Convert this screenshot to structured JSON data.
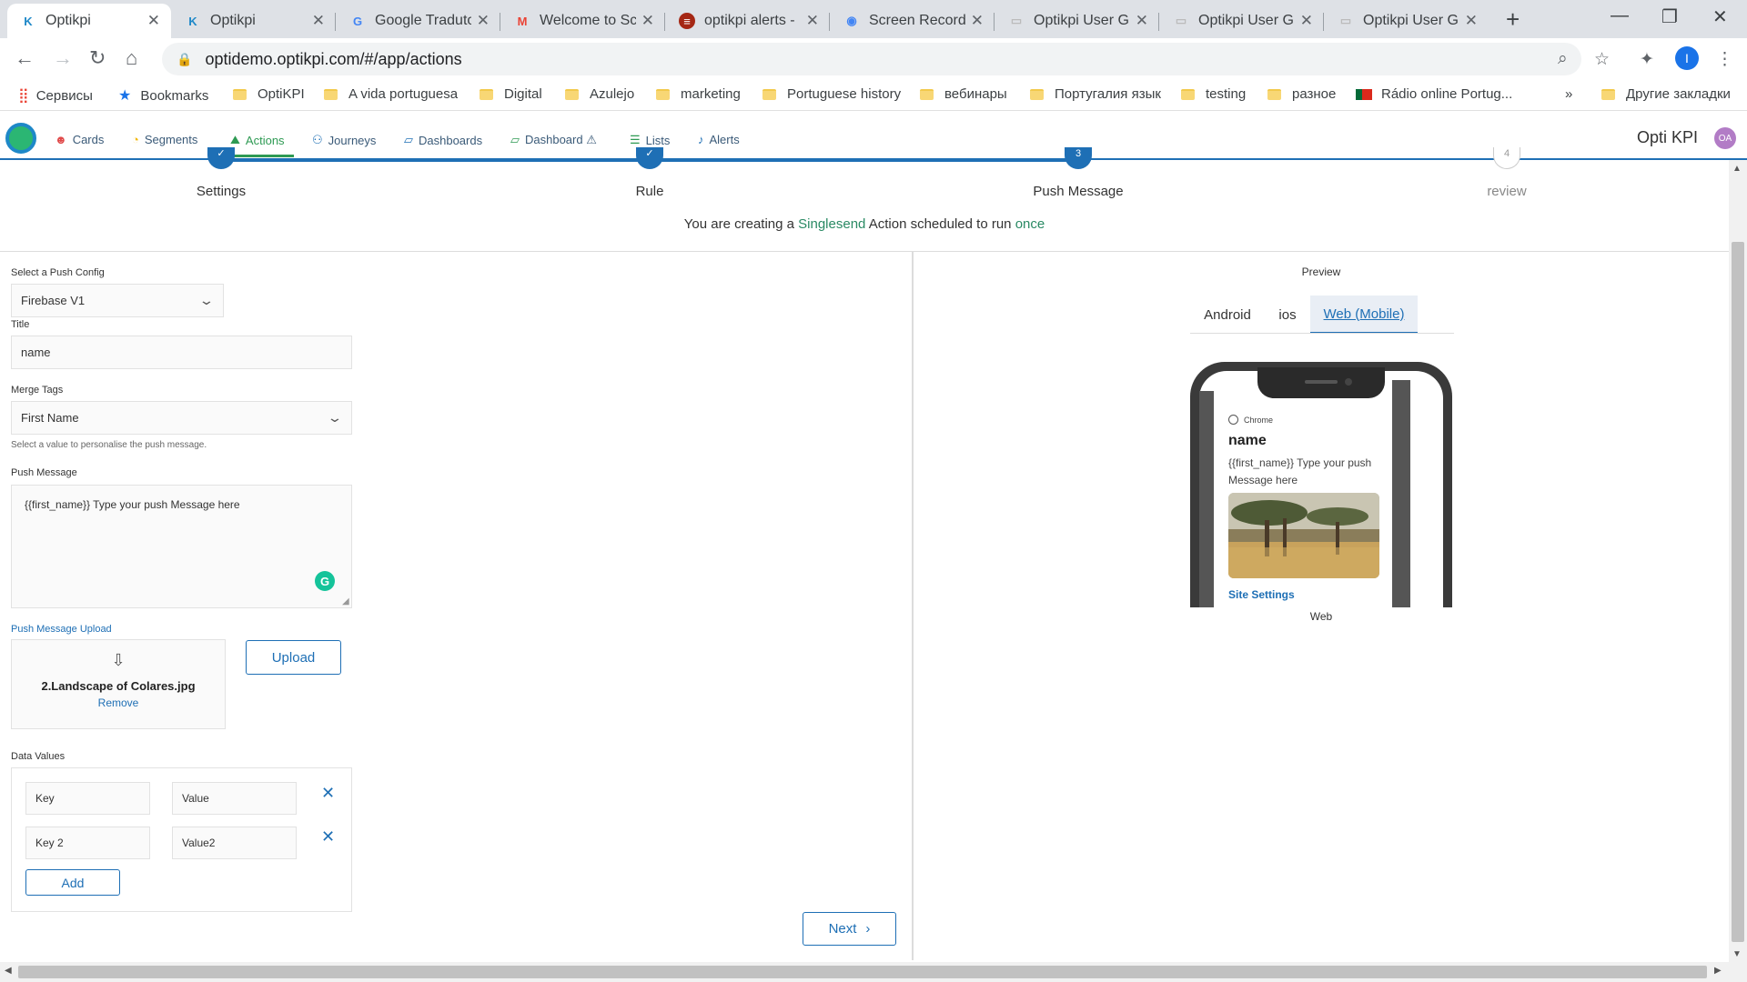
{
  "browser": {
    "tabs": [
      {
        "title": "Optikpi",
        "icon": "optikpi-icon",
        "fav": "K"
      },
      {
        "title": "Optikpi",
        "icon": "optikpi-icon",
        "fav": "K"
      },
      {
        "title": "Google Traduto",
        "icon": "google-translate-icon",
        "fav": "G"
      },
      {
        "title": "Welcome to Sc",
        "icon": "gmail-icon",
        "fav": "M"
      },
      {
        "title": "optikpi alerts -",
        "icon": "alerts-icon",
        "fav": "≡"
      },
      {
        "title": "Screen Recorde",
        "icon": "screen-recorder-icon",
        "fav": "◉"
      },
      {
        "title": "Optikpi User G",
        "icon": "doc-icon",
        "fav": "▭"
      },
      {
        "title": "Optikpi User G",
        "icon": "doc-icon",
        "fav": "▭"
      },
      {
        "title": "Optikpi User G",
        "icon": "doc-icon",
        "fav": "▭"
      }
    ],
    "url": "optidemo.optikpi.com/#/app/actions",
    "profile_initial": "I"
  },
  "bookmarks": {
    "apps": "Сервисы",
    "items": [
      "Bookmarks",
      "OptiKPI",
      "A vida portuguesa",
      "Digital",
      "Azulejo",
      "marketing",
      "Portuguese history",
      "вебинары",
      "Португалия язык",
      "testing",
      "разное",
      "Rádio online Portug..."
    ],
    "more": "»",
    "other": "Другие закладки"
  },
  "app": {
    "nav": [
      {
        "label": "Cards",
        "icon": "cards-icon",
        "glyph": "☻"
      },
      {
        "label": "Segments",
        "icon": "segments-icon",
        "glyph": "◔"
      },
      {
        "label": "Actions",
        "icon": "actions-icon",
        "glyph": "⛰"
      },
      {
        "label": "Journeys",
        "icon": "journeys-icon",
        "glyph": "⚇"
      },
      {
        "label": "Dashboards",
        "icon": "dashboards-icon",
        "glyph": "▱"
      },
      {
        "label": "Dashboard ⚠",
        "icon": "dashboard-icon",
        "glyph": "▱"
      },
      {
        "label": "Lists",
        "icon": "lists-icon",
        "glyph": "☰"
      },
      {
        "label": "Alerts",
        "icon": "alerts-bell-icon",
        "glyph": "🔔"
      }
    ],
    "active_nav": "Actions",
    "title": "Opti KPI",
    "avatar": "OA"
  },
  "wizard": {
    "steps": [
      {
        "label": "Settings",
        "marker": "✓",
        "done": true
      },
      {
        "label": "Rule",
        "marker": "✓",
        "done": true
      },
      {
        "label": "Push Message",
        "marker": "3",
        "done": true
      },
      {
        "label": "review",
        "marker": "4",
        "done": false
      }
    ],
    "creating_prefix": "You are creating a",
    "creating_type": "Singlesend",
    "creating_mid": "Action scheduled to run",
    "creating_freq": "once"
  },
  "form": {
    "push_config_label": "Select a Push Config",
    "push_config_value": "Firebase V1",
    "title_label": "Title",
    "title_value": "name",
    "merge_tags_label": "Merge Tags",
    "merge_tags_value": "First Name",
    "merge_tags_hint": "Select a value to personalise the push message.",
    "push_message_label": "Push Message",
    "push_message_value": "{{first_name}} Type your push Message here",
    "upload_label": "Push Message Upload",
    "upload_filename": "2.Landscape of Colares.jpg",
    "upload_remove": "Remove",
    "upload_button": "Upload",
    "data_values_label": "Data Values",
    "data_values": [
      {
        "key": "Key",
        "value": "Value"
      },
      {
        "key": "Key 2",
        "value": "Value2"
      }
    ],
    "add_button": "Add",
    "next_button": "Next"
  },
  "preview": {
    "title": "Preview",
    "tabs": [
      "Android",
      "ios",
      "Web (Mobile)"
    ],
    "active_tab": "Web (Mobile)",
    "browser_name": "Chrome",
    "notif_title": "name",
    "notif_body": "{{first_name}} Type your push Message here",
    "notif_link": "Site Settings",
    "platform_label": "Web"
  },
  "colors": {
    "accent_blue": "#1e6fb5",
    "active_green": "#2e9a53",
    "singlesend_green": "#2a8a64"
  }
}
